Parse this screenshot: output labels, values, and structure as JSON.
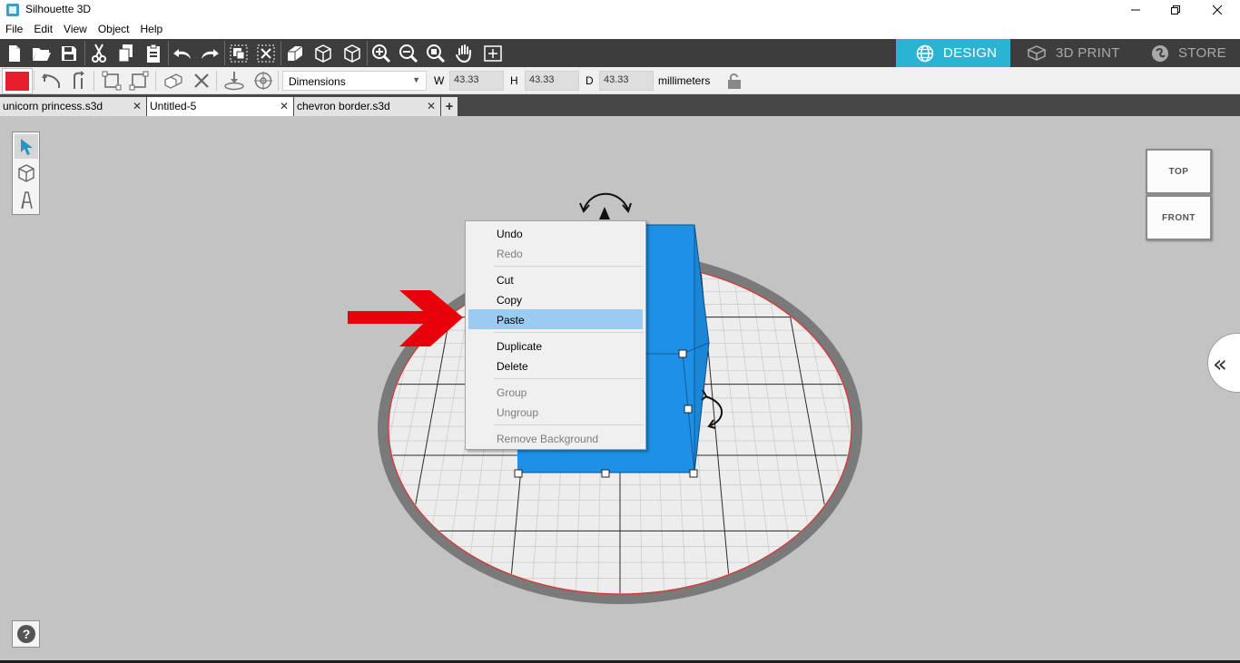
{
  "window": {
    "title": "Silhouette 3D",
    "icons": {
      "app": "silhouette-app-icon",
      "minimize": "minimize-icon",
      "restore": "restore-icon",
      "close": "close-icon"
    }
  },
  "menu": [
    {
      "label": "File"
    },
    {
      "label": "Edit"
    },
    {
      "label": "View"
    },
    {
      "label": "Object"
    },
    {
      "label": "Help"
    }
  ],
  "toolbar": {
    "tools": [
      "new-file-icon",
      "open-folder-icon",
      "save-icon",
      "cut-icon",
      "copy-icon",
      "paste-icon",
      "undo-icon",
      "redo-icon",
      "group-icon",
      "ungroup-icon",
      "extrude-icon",
      "box-icon",
      "box-outline-icon",
      "zoom-in-icon",
      "zoom-out-icon",
      "zoom-fit-icon",
      "pan-hand-icon",
      "fit-view-icon"
    ]
  },
  "modes": [
    {
      "label": "DESIGN",
      "icon": "globe-icon",
      "active": true
    },
    {
      "label": "3D PRINT",
      "icon": "print-3d-icon",
      "active": false
    },
    {
      "label": "STORE",
      "icon": "store-icon",
      "active": false
    }
  ],
  "toolbar2": {
    "color": "#e81f2a",
    "tools": [
      "rotate-left-icon",
      "flip-icon",
      "align-icon",
      "distribute-icon",
      "duplicate-icon",
      "delete-icon",
      "drop-to-bed-icon",
      "center-icon"
    ],
    "dimensions": {
      "mode": "Dimensions",
      "w_label": "W",
      "w_value": "43.33",
      "h_label": "H",
      "h_value": "43.33",
      "d_label": "D",
      "d_value": "43.33",
      "unit": "millimeters",
      "lock_icon": "lock-icon"
    }
  },
  "tabs": [
    {
      "label": "unicorn princess.s3d",
      "active": false
    },
    {
      "label": "Untitled-5",
      "active": true
    },
    {
      "label": "chevron border.s3d",
      "active": false
    }
  ],
  "tab_close_glyph": "✕",
  "add_tab_glyph": "+",
  "palette": [
    "select-arrow-icon",
    "cube-icon",
    "text-icon"
  ],
  "view_cube": {
    "top": "TOP",
    "front": "FRONT"
  },
  "collapse_glyph": "«",
  "help_icon": "help-icon",
  "context_menu": {
    "items": [
      {
        "label": "Undo",
        "enabled": true
      },
      {
        "label": "Redo",
        "enabled": false
      },
      {
        "label": "Cut",
        "enabled": true
      },
      {
        "label": "Copy",
        "enabled": true
      },
      {
        "label": "Paste",
        "enabled": true,
        "highlighted": true
      },
      {
        "label": "Duplicate",
        "enabled": true
      },
      {
        "label": "Delete",
        "enabled": true
      },
      {
        "label": "Group",
        "enabled": false
      },
      {
        "label": "Ungroup",
        "enabled": false
      },
      {
        "label": "Remove Background",
        "enabled": false
      }
    ]
  },
  "colors": {
    "accent": "#2bb3d3",
    "object": "#1e90e6",
    "annotation_arrow": "#e8000a",
    "menu_highlight": "#99ccf0"
  }
}
